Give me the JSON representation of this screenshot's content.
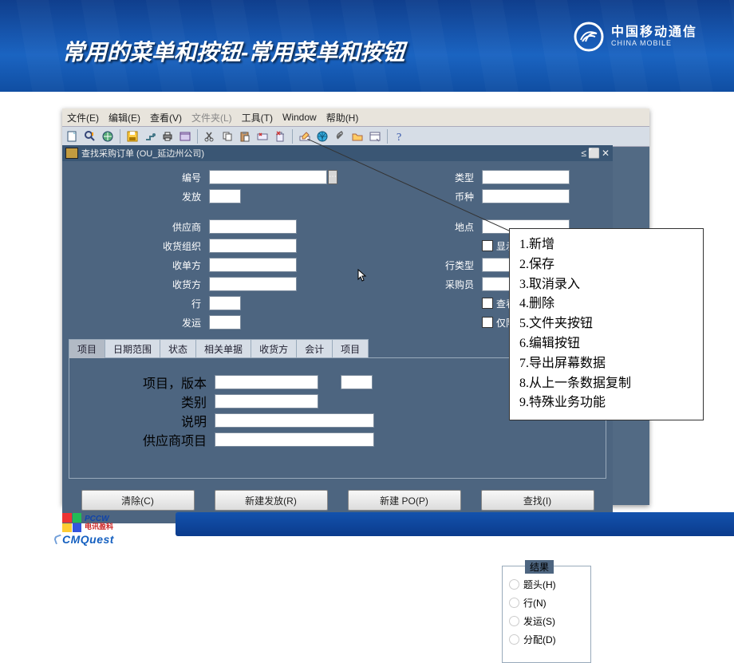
{
  "slide": {
    "title": "常用的菜单和按钮-常用菜单和按钮",
    "brand_cn": "中国移动通信",
    "brand_en": "CHINA MOBILE"
  },
  "menu": {
    "file": "文件(E)",
    "edit": "编辑(E)",
    "view": "查看(V)",
    "folder": "文件夹(L)",
    "tools": "工具(T)",
    "window": "Window",
    "help": "帮助(H)"
  },
  "mdi": {
    "title": "查找采购订单 (OU_延边州公司)"
  },
  "labels": {
    "number": "编号",
    "type": "类型",
    "release": "发放",
    "currency": "币种",
    "supplier": "供应商",
    "site": "地点",
    "receiving_org": "收货组织",
    "show_ext": "显示外部地点(Q)",
    "ship_to": "收单方",
    "line_type": "行类型",
    "bill_to": "收货方",
    "buyer": "采购员",
    "line": "行",
    "view_releases": "查看发放(A)",
    "shipment": "发运",
    "limit_vmi": "仅限于 VMI..."
  },
  "tabs": {
    "items": "项目",
    "date": "日期范围",
    "status": "状态",
    "related": "相关单据",
    "bill": "收货方",
    "account": "会计",
    "project": "项目"
  },
  "itemtab": {
    "itemrev": "项目，版本",
    "category": "类别",
    "desc": "说明",
    "supitem": "供应商项目"
  },
  "result": {
    "title": "结果",
    "header": "题头(H)",
    "lines": "行(N)",
    "ship": "发运(S)",
    "dist": "分配(D)"
  },
  "buttons": {
    "clear": "清除(C)",
    "new_release": "新建发放(R)",
    "new": "新建 PO(P)",
    "find": "查找(I)"
  },
  "annotation": {
    "1": "1.新增",
    "2": "2.保存",
    "3": "3.取消录入",
    "4": "4.删除",
    "5": "5.文件夹按钮",
    "6": "6.编辑按钮",
    "7": "7.导出屏幕数据",
    "8": "8.从上一条数据复制",
    "9": "9.特殊业务功能"
  },
  "footer": {
    "pccw1": "PCCW",
    "pccw2": "电讯盈科",
    "cmquest": "CMQuest"
  }
}
